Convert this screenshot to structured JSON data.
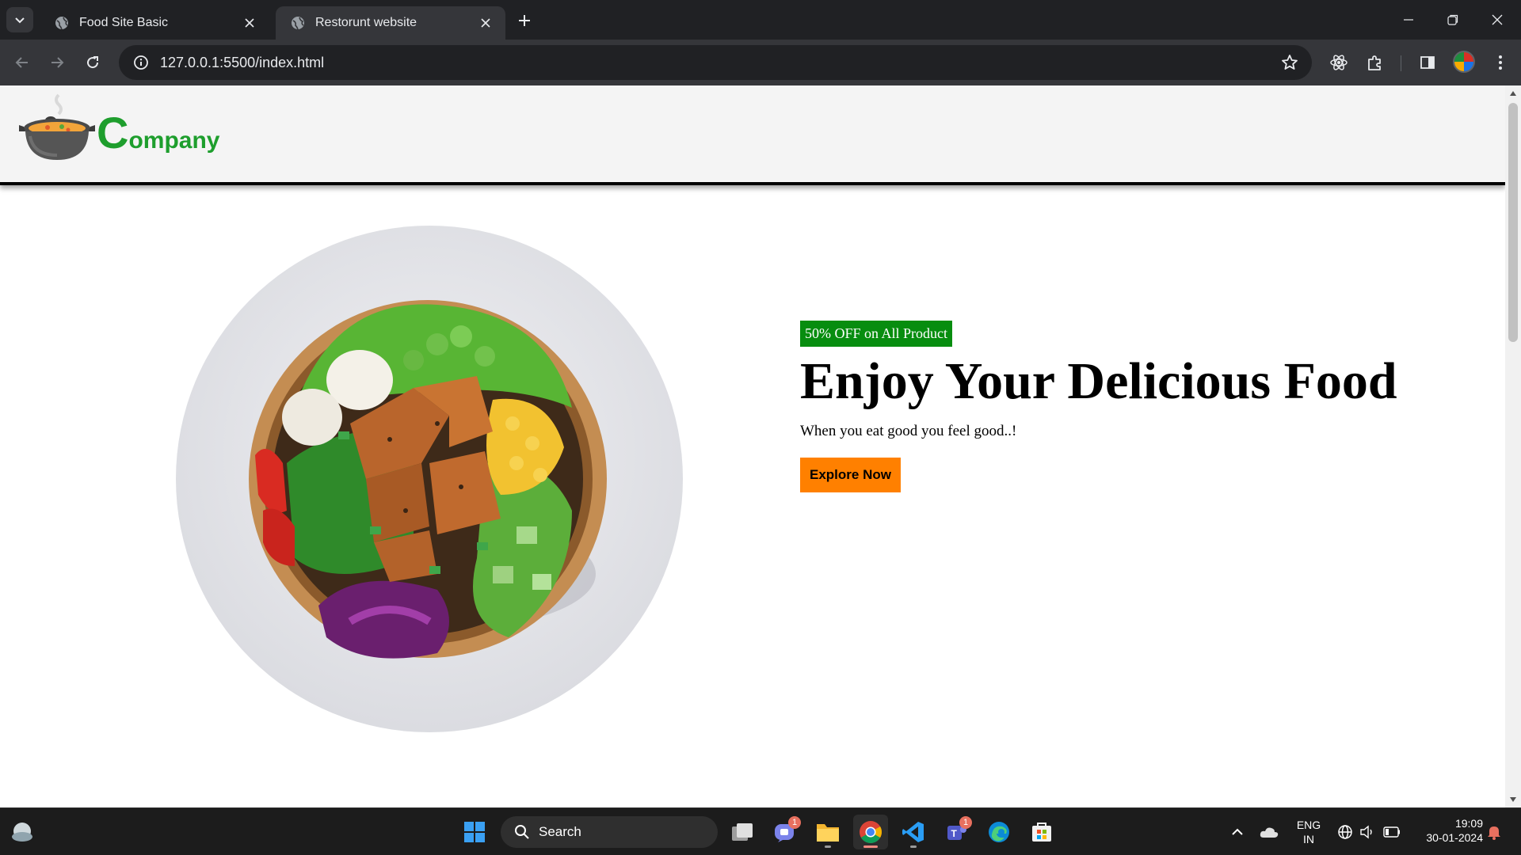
{
  "browser": {
    "tabs": [
      {
        "label": "Food Site Basic",
        "active": false
      },
      {
        "label": "Restorunt website",
        "active": true
      }
    ],
    "url": "127.0.0.1:5500/index.html"
  },
  "site": {
    "logo": {
      "cap": "C",
      "rest": "ompany",
      "color": "#1e9e2d"
    },
    "hero": {
      "badge": "50% OFF on All Product",
      "headline": "Enjoy Your Delicious Food",
      "subtitle": "When you eat good you feel good..!",
      "cta": "Explore Now"
    },
    "colors": {
      "badge": "#078d0f",
      "cta": "#ff8000"
    }
  },
  "taskbar": {
    "search_placeholder": "Search",
    "language": {
      "line1": "ENG",
      "line2": "IN"
    },
    "time": "19:09",
    "date": "30-01-2024",
    "badges": {
      "chat": "1",
      "teams": "1"
    }
  }
}
